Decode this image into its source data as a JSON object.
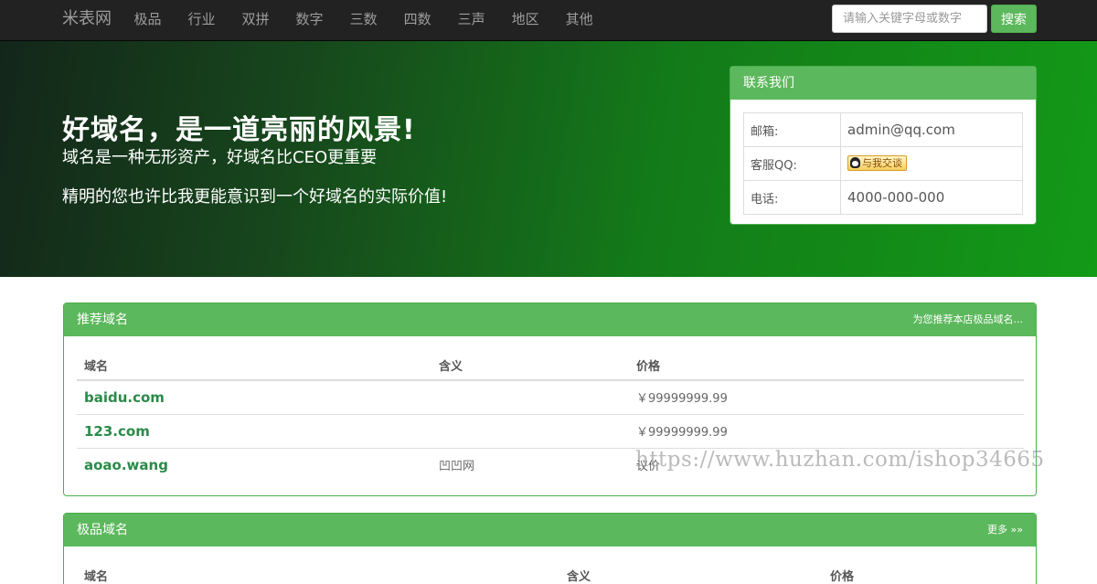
{
  "navbar": {
    "brand": "米表网",
    "items": [
      "极品",
      "行业",
      "双拼",
      "数字",
      "三数",
      "四数",
      "三声",
      "地区",
      "其他"
    ],
    "search_placeholder": "请输入关键字母或数字",
    "search_button": "搜索"
  },
  "hero": {
    "title": "好域名，是一道亮丽的风景!",
    "subtitle1": "域名是一种无形资产，好域名比CEO更重要",
    "subtitle2": "精明的您也许比我更能意识到一个好域名的实际价值!"
  },
  "contact": {
    "title": "联系我们",
    "rows": [
      {
        "label": "邮箱:",
        "value": "admin@qq.com"
      },
      {
        "label": "客服QQ:",
        "badge": "与我交谈"
      },
      {
        "label": "电话:",
        "value": "4000-000-000"
      }
    ]
  },
  "recommended": {
    "title": "推荐域名",
    "note": "为您推荐本店极品域名...",
    "columns": [
      "域名",
      "含义",
      "价格"
    ],
    "rows": [
      {
        "domain": "baidu.com",
        "meaning": "",
        "price": "￥99999999.99"
      },
      {
        "domain": "123.com",
        "meaning": "",
        "price": "￥99999999.99"
      },
      {
        "domain": "aoao.wang",
        "meaning": "凹凹网",
        "price": "议价"
      }
    ]
  },
  "premium": {
    "title": "极品域名",
    "more": "更多 »»",
    "columns": [
      "域名",
      "含义",
      "价格"
    ]
  },
  "watermark": "https://www.huzhan.com/ishop34665"
}
